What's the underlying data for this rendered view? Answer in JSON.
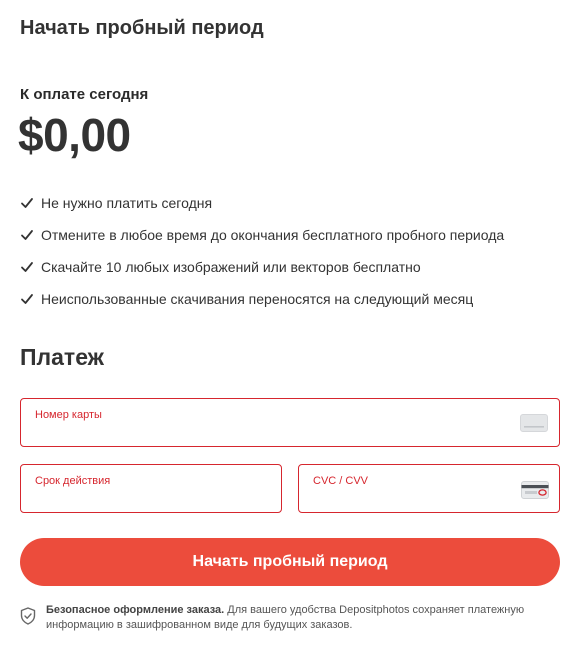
{
  "header": {
    "title": "Начать пробный период"
  },
  "pricing": {
    "label": "К оплате сегодня",
    "amount": "$0,00"
  },
  "benefits": [
    "Не нужно платить сегодня",
    "Отмените в любое время до окончания бесплатного пробного периода",
    "Скачайте 10 любых изображений или векторов бесплатно",
    "Неиспользованные скачивания переносятся на следующий месяц"
  ],
  "payment": {
    "title": "Платеж",
    "card_number_label": "Номер карты",
    "expiry_label": "Срок действия",
    "cvc_label": "CVC / CVV",
    "submit_label": "Начать пробный период"
  },
  "security": {
    "title": "Безопасное оформление заказа.",
    "text": "Для вашего удобства Depositphotos сохраняет платежную информацию в зашифрованном виде для будущих заказов."
  },
  "colors": {
    "accent": "#ec4c3c",
    "error": "#d6262e",
    "text": "#333333"
  },
  "icons": {
    "check": "check-icon",
    "card": "card-icon",
    "cvc": "cvc-card-icon",
    "shield": "shield-check-icon"
  }
}
